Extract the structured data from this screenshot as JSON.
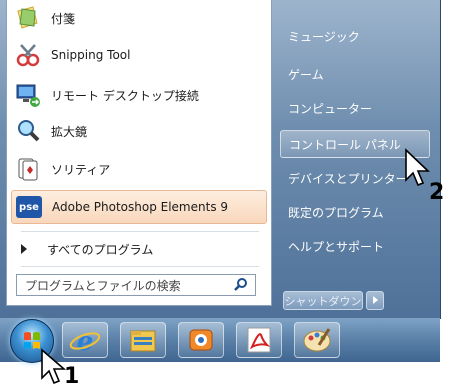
{
  "left_programs": [
    {
      "label": "付箋",
      "icon": "sticky-notes-icon"
    },
    {
      "label": "Snipping Tool",
      "icon": "snipping-tool-icon"
    },
    {
      "label": "リモート デスクトップ接続",
      "icon": "remote-desktop-icon"
    },
    {
      "label": "拡大鏡",
      "icon": "magnifier-icon"
    },
    {
      "label": "ソリティア",
      "icon": "solitaire-icon"
    },
    {
      "label": "Adobe Photoshop Elements 9",
      "icon": "photoshop-elements-icon"
    }
  ],
  "all_programs_label": "すべてのプログラム",
  "search": {
    "placeholder": "プログラムとファイルの検索"
  },
  "right_items": [
    {
      "label": "ミュージック"
    },
    {
      "label": "ゲーム"
    },
    {
      "label": "コンピューター"
    },
    {
      "label": "コントロール パネル"
    },
    {
      "label": "デバイスとプリンター"
    },
    {
      "label": "既定のプログラム"
    },
    {
      "label": "ヘルプとサポート"
    }
  ],
  "shutdown_label": "シャットダウン",
  "taskbar_icons": [
    "internet-explorer-icon",
    "file-explorer-icon",
    "media-player-icon",
    "pdf-reader-icon",
    "paint-icon"
  ],
  "step_labels": {
    "step1": "1",
    "step2": "2"
  },
  "photoshop_badge": "pse"
}
